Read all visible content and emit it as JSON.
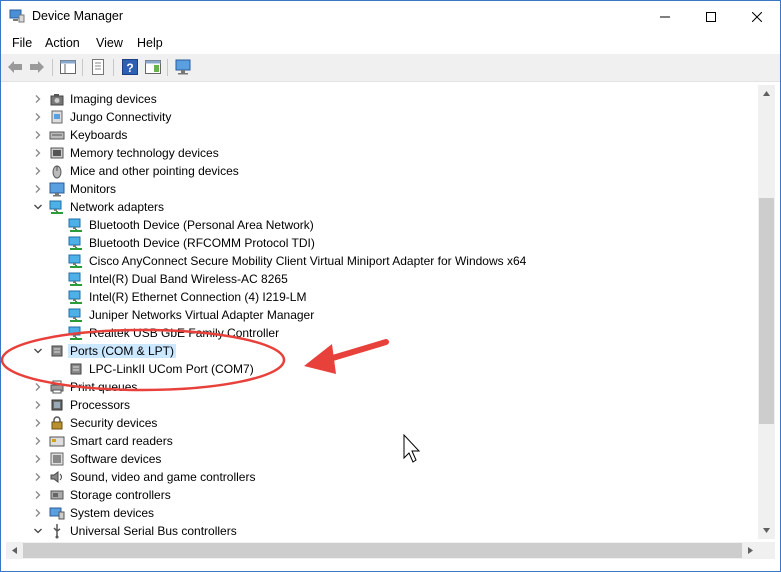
{
  "window": {
    "title": "Device Manager"
  },
  "menu": [
    "File",
    "Action",
    "View",
    "Help"
  ],
  "tree": [
    {
      "label": "Imaging devices",
      "icon": "imaging-icon",
      "level": 0,
      "expander": "collapsed"
    },
    {
      "label": "Jungo Connectivity",
      "icon": "usb-device-icon",
      "level": 0,
      "expander": "collapsed"
    },
    {
      "label": "Keyboards",
      "icon": "keyboard-icon",
      "level": 0,
      "expander": "collapsed"
    },
    {
      "label": "Memory technology devices",
      "icon": "memory-icon",
      "level": 0,
      "expander": "collapsed"
    },
    {
      "label": "Mice and other pointing devices",
      "icon": "mouse-icon",
      "level": 0,
      "expander": "collapsed"
    },
    {
      "label": "Monitors",
      "icon": "monitor-icon",
      "level": 0,
      "expander": "collapsed"
    },
    {
      "label": "Network adapters",
      "icon": "network-icon",
      "level": 0,
      "expander": "expanded"
    },
    {
      "label": "Bluetooth Device (Personal Area Network)",
      "icon": "network-icon",
      "level": 1
    },
    {
      "label": "Bluetooth Device (RFCOMM Protocol TDI)",
      "icon": "network-icon",
      "level": 1
    },
    {
      "label": "Cisco AnyConnect Secure Mobility Client Virtual Miniport Adapter for Windows x64",
      "icon": "network-icon",
      "level": 1
    },
    {
      "label": "Intel(R) Dual Band Wireless-AC 8265",
      "icon": "network-icon",
      "level": 1
    },
    {
      "label": "Intel(R) Ethernet Connection (4) I219-LM",
      "icon": "network-icon",
      "level": 1
    },
    {
      "label": "Juniper Networks Virtual Adapter Manager",
      "icon": "network-icon",
      "level": 1
    },
    {
      "label": "Realtek USB GbE Family Controller",
      "icon": "network-icon",
      "level": 1
    },
    {
      "label": "Ports (COM & LPT)",
      "icon": "port-icon",
      "level": 0,
      "expander": "expanded",
      "selected": true
    },
    {
      "label": "LPC-LinkII UCom Port (COM7)",
      "icon": "port-icon",
      "level": 1
    },
    {
      "label": "Print queues",
      "icon": "printer-icon",
      "level": 0,
      "expander": "collapsed"
    },
    {
      "label": "Processors",
      "icon": "processor-icon",
      "level": 0,
      "expander": "collapsed"
    },
    {
      "label": "Security devices",
      "icon": "security-icon",
      "level": 0,
      "expander": "collapsed"
    },
    {
      "label": "Smart card readers",
      "icon": "smartcard-icon",
      "level": 0,
      "expander": "collapsed"
    },
    {
      "label": "Software devices",
      "icon": "software-icon",
      "level": 0,
      "expander": "collapsed"
    },
    {
      "label": "Sound, video and game controllers",
      "icon": "sound-icon",
      "level": 0,
      "expander": "collapsed"
    },
    {
      "label": "Storage controllers",
      "icon": "storage-icon",
      "level": 0,
      "expander": "collapsed"
    },
    {
      "label": "System devices",
      "icon": "system-icon",
      "level": 0,
      "expander": "collapsed"
    },
    {
      "label": "Universal Serial Bus controllers",
      "icon": "usb-icon",
      "level": 0,
      "expander": "expanded"
    }
  ],
  "colors": {
    "selection": "#cce8ff",
    "annotation": "#e8403a",
    "window_border": "#3a78c5"
  }
}
